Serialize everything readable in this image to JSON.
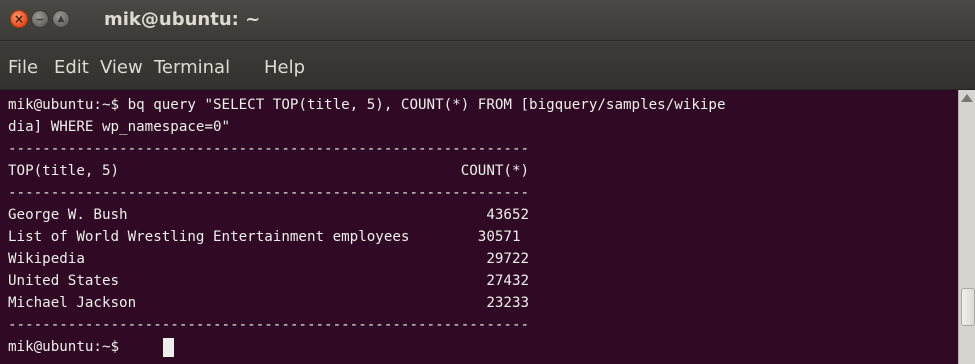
{
  "window": {
    "title": "mik@ubuntu: ~",
    "buttons": {
      "close": "×",
      "minimize": "−",
      "maximize": "▲"
    }
  },
  "menu": [
    "File",
    "Edit",
    "View",
    "Terminal",
    "Help"
  ],
  "terminal": {
    "lines": [
      "mik@ubuntu:~$ bq query \"SELECT TOP(title, 5), COUNT(*) FROM [bigquery/samples/wikipe",
      "dia] WHERE wp_namespace=0\"",
      "-------------------------------------------------------------",
      "TOP(title, 5)                                        COUNT(*)",
      "-------------------------------------------------------------",
      "George W. Bush                                          43652",
      "List of World Wrestling Entertainment employees        30571",
      "Wikipedia                                               29722",
      "United States                                           27432",
      "Michael Jackson                                         23233",
      "-------------------------------------------------------------",
      "mik@ubuntu:~$ "
    ],
    "prompt": "mik@ubuntu:~$ "
  },
  "results": {
    "headers": [
      "TOP(title, 5)",
      "COUNT(*)"
    ],
    "rows": [
      [
        "George W. Bush",
        43652
      ],
      [
        "List of World Wrestling Entertainment employees",
        30571
      ],
      [
        "Wikipedia",
        29722
      ],
      [
        "United States",
        27432
      ],
      [
        "Michael Jackson",
        23233
      ]
    ]
  },
  "colors": {
    "terminal_bg": "#300a24",
    "terminal_fg": "#eeeeec",
    "titlebar_bg": "#3c3b37",
    "close_button": "#e8562a"
  }
}
